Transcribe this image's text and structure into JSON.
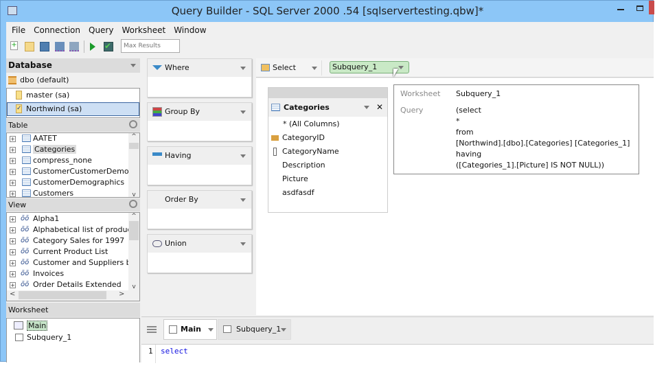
{
  "window": {
    "title": "Query Builder - SQL Server 2000 .54 [sqlservertesting.qbw]*"
  },
  "menu": [
    "File",
    "Connection",
    "Query",
    "Worksheet",
    "Window"
  ],
  "toolbar": {
    "max_results_placeholder": "Max Results"
  },
  "database": {
    "header": "Database",
    "schema": "dbo (default)",
    "items": [
      "master (sa)",
      "Northwind (sa)"
    ],
    "selected": "Northwind (sa)"
  },
  "tables": {
    "header": "Table",
    "items": [
      "AATET",
      "Categories",
      "compress_none",
      "CustomerCustomerDemo",
      "CustomerDemographics",
      "Customers"
    ],
    "selected": "Categories"
  },
  "views": {
    "header": "View",
    "items": [
      "Alpha1",
      "Alphabetical list of products",
      "Category Sales for 1997",
      "Current Product List",
      "Customer and Suppliers by C",
      "Invoices",
      "Order Details Extended"
    ]
  },
  "worksheets": {
    "header": "Worksheet",
    "items": [
      "Main",
      "Subquery_1"
    ],
    "selected": "Main"
  },
  "clauses": [
    "Where",
    "Group By",
    "Having",
    "Order By",
    "Union"
  ],
  "query_toolbar": {
    "select_label": "Select",
    "subquery_value": "Subquery_1"
  },
  "table_box": {
    "title": "Categories",
    "columns": [
      "* (All Columns)",
      "CategoryID",
      "CategoryName",
      "Description",
      "Picture",
      "asdfasdf"
    ]
  },
  "tooltip": {
    "worksheet_label": "Worksheet",
    "worksheet_value": "Subquery_1",
    "query_label": "Query",
    "query_lines": [
      "(select",
      "*",
      "from",
      "[Northwind].[dbo].[Categories] [Categories_1]",
      "having",
      "([Categories_1].[Picture] IS NOT NULL))"
    ]
  },
  "tabs": [
    {
      "label": "Main",
      "active": true
    },
    {
      "label": "Subquery_1",
      "active": false
    }
  ],
  "editor": {
    "line_number": "1",
    "code": "select"
  }
}
